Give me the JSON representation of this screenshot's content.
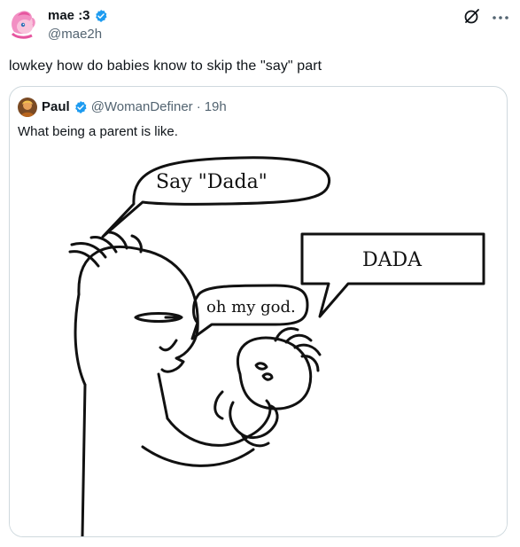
{
  "post": {
    "author": {
      "display_name": "mae :3",
      "handle": "@mae2h"
    },
    "text": "lowkey how do babies know to skip the \"say\" part"
  },
  "quoted_post": {
    "author": {
      "display_name": "Paul",
      "handle": "@WomanDefiner"
    },
    "separator": "·",
    "time": "19h",
    "text": "What being a parent is like."
  },
  "comic": {
    "parent_speech": "Say \"Dada\"",
    "baby_speech": "DADA",
    "parent_reaction": "oh my god."
  },
  "icons": {
    "verified": "verified-badge-icon",
    "grok": "grok-icon",
    "more": "more-options-icon"
  },
  "colors": {
    "verified_blue": "#1d9bf0",
    "text_primary": "#0f1419",
    "text_secondary": "#536471",
    "border": "#cfd9de"
  }
}
